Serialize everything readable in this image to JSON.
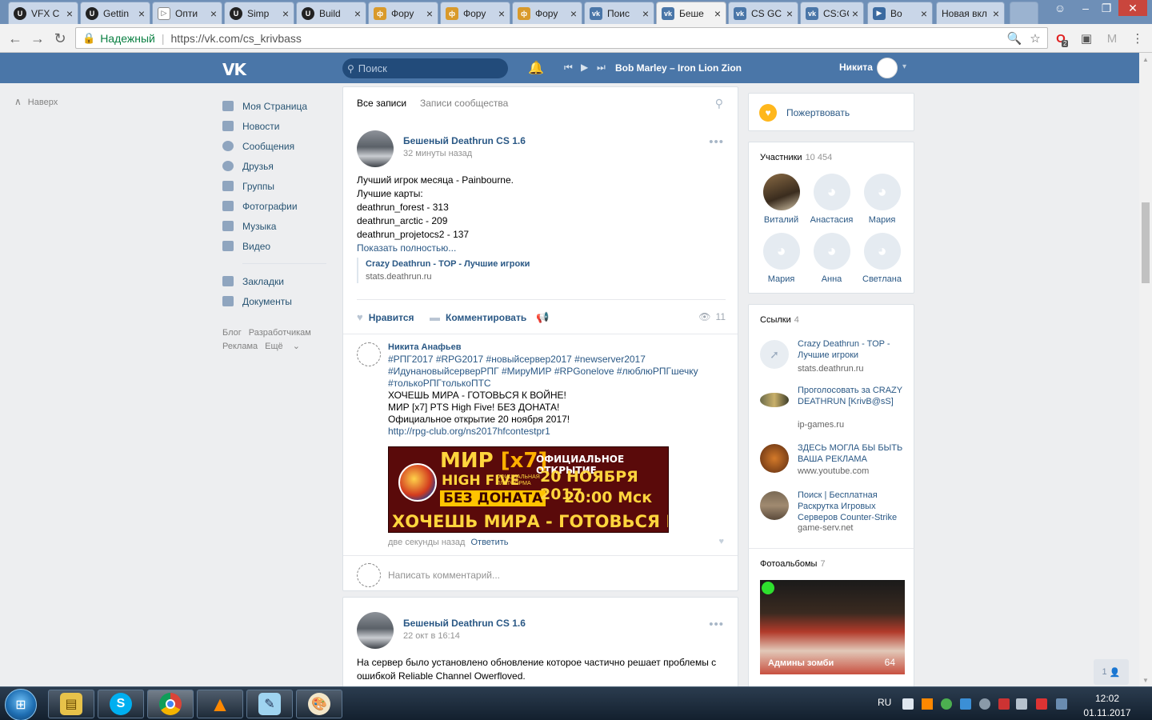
{
  "browser": {
    "tabs": [
      {
        "label": "VFX C",
        "icon": "unreal-icon"
      },
      {
        "label": "Gettin",
        "icon": "unreal-icon"
      },
      {
        "label": "Опти",
        "icon": "play-icon"
      },
      {
        "label": "Simp",
        "icon": "unreal-icon"
      },
      {
        "label": "Build",
        "icon": "unreal-icon"
      },
      {
        "label": "Фору",
        "icon": "forum-icon"
      },
      {
        "label": "Фору",
        "icon": "forum-icon"
      },
      {
        "label": "Фору",
        "icon": "forum-icon"
      },
      {
        "label": "Поис",
        "icon": "vk-icon"
      },
      {
        "label": "Беше",
        "icon": "vk-icon"
      },
      {
        "label": "CS GC",
        "icon": "vk-icon"
      },
      {
        "label": "CS:GC",
        "icon": "vk-icon"
      },
      {
        "label": "Bo",
        "icon": "play-icon"
      },
      {
        "label": "Новая вкл",
        "icon": ""
      }
    ],
    "omnibox": {
      "secure_label": "Надежный",
      "url": "https://vk.com/cs_krivbass"
    },
    "opera_badge": "2"
  },
  "vk": {
    "header": {
      "logo": "VK",
      "search_placeholder": "Поиск",
      "track": "Bob Marley – Iron Lion Zion",
      "username": "Никита"
    },
    "back_to_top": "Наверх",
    "menu": {
      "items": [
        {
          "label": "Моя Страница",
          "icon": "home-icon"
        },
        {
          "label": "Новости",
          "icon": "news-icon"
        },
        {
          "label": "Сообщения",
          "icon": "messages-icon"
        },
        {
          "label": "Друзья",
          "icon": "friends-icon"
        },
        {
          "label": "Группы",
          "icon": "groups-icon"
        },
        {
          "label": "Фотографии",
          "icon": "photos-icon"
        },
        {
          "label": "Музыка",
          "icon": "music-icon"
        },
        {
          "label": "Видео",
          "icon": "video-icon"
        }
      ],
      "items2": [
        {
          "label": "Закладки",
          "icon": "bookmarks-icon"
        },
        {
          "label": "Документы",
          "icon": "documents-icon"
        }
      ],
      "footer": {
        "blog": "Блог",
        "dev": "Разработчикам",
        "ads": "Реклама",
        "more": "Ещё"
      }
    },
    "feed_tabs": {
      "all": "Все записи",
      "community": "Записи сообщества"
    },
    "post1": {
      "author": "Бешеный Deathrun CS 1.6",
      "date": "32 минуты назад",
      "lines": [
        "Лучший игрок месяца - Painbourne.",
        "Лучшие карты:",
        "deathrun_forest - 313",
        "deathrun_arctic - 209",
        "deathrun_projetocs2 - 137"
      ],
      "show_more": "Показать полностью...",
      "ref_title": "Crazy Deathrun - TOP - Лучшие игроки",
      "ref_url": "stats.deathrun.ru",
      "like_label": "Нравится",
      "comment_label": "Комментировать",
      "views": "11",
      "comment": {
        "author": "Никита Анафьев",
        "hashtags1": "#РПГ2017 #RPG2017 #новыйсервер2017 #newserver2017",
        "hashtags2": "#ИдунановыйсерверРПГ #МируМИР #RPGonelove #люблюРПГшечку",
        "hashtags3": "#толькоРПГтолькоПТС",
        "line1": "ХОЧЕШЬ МИРА - ГОТОВЬСЯ К ВОЙНЕ!",
        "line2": "МИР [x7] PTS High Five! БЕЗ ДОНАТА!",
        "line3": "Официальное открытие 20 ноября 2017!",
        "link": "http://rpg-club.org/ns2017hfcontestpr1",
        "banner": {
          "mir": "МИР",
          "x7": "[x7]",
          "hf": "HIGH FIVE",
          "hf_sub1": "ОФИЦИАЛЬНАЯ",
          "hf_sub2": "ПЛАТФОРМА",
          "nodonate": "БЕЗ ДОНАТА",
          "official": "ОФИЦИАЛЬНОЕ ОТКРЫТИЕ",
          "date": "20 НОЯБРЯ 2017",
          "time": "20:00 Мск",
          "slogan": "ХОЧЕШЬ МИРА - ГОТОВЬСЯ К ВОЙНЕ"
        },
        "time": "две секунды назад",
        "reply": "Ответить"
      },
      "write_comment_placeholder": "Написать комментарий..."
    },
    "post2": {
      "author": "Бешеный Deathrun CS 1.6",
      "date": "22 окт в 16:14",
      "text1": "На сервер было установлено обновление которое частично решает проблемы с",
      "text2": "ошибкой Reliable Channel Owerfloved."
    },
    "donate": "Пожертвовать",
    "members": {
      "title": "Участники",
      "count": "10 454",
      "list": [
        "Виталий",
        "Анастасия",
        "Мария",
        "Мария",
        "Анна",
        "Светлана"
      ]
    },
    "links": {
      "title": "Ссылки",
      "count": "4",
      "items": [
        {
          "title": "Crazy Deathrun - TOP - Лучшие игроки",
          "url": "stats.deathrun.ru"
        },
        {
          "title": "Проголосовать за CRAZY DEATHRUN [KrivB@sS]",
          "url": "ip-games.ru"
        },
        {
          "title": "ЗДЕСЬ МОГЛА БЫ БЫТЬ ВАША РЕКЛАМА",
          "url": "www.youtube.com"
        },
        {
          "title": "Поиск | Бесплатная Раскрутка Игровых Серверов Counter-Strike",
          "url": "game-serv.net"
        }
      ]
    },
    "albums": {
      "title": "Фотоальбомы",
      "count": "7",
      "album_name": "Админы зомби",
      "album_count": "64"
    },
    "scroll_button": "1"
  },
  "taskbar": {
    "lang": "RU",
    "time": "12:02",
    "date": "01.11.2017"
  }
}
